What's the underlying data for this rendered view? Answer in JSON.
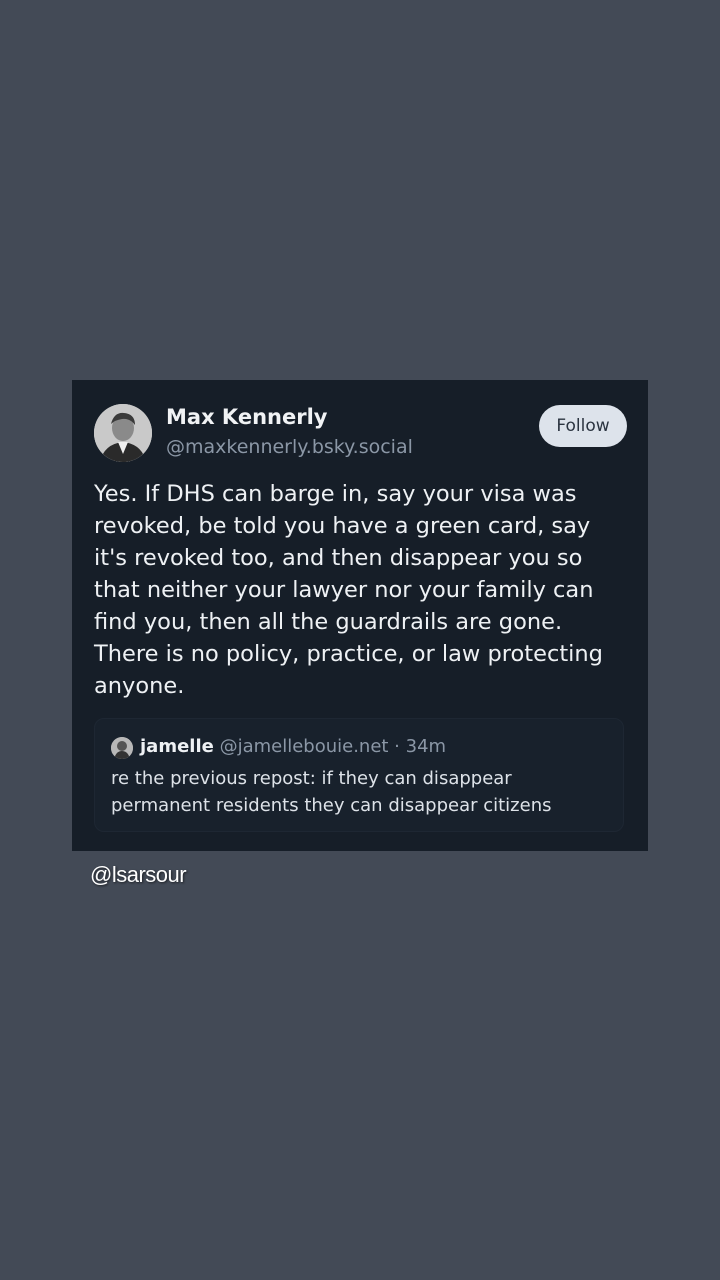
{
  "post": {
    "author_name": "Max Kennerly",
    "author_handle": "@maxkennerly.bsky.social",
    "follow_label": "Follow",
    "avatar_icon": "person-photo-avatar",
    "body_lines": [
      "Yes. If DHS can barge in, say your visa was",
      "revoked, be told you have a green card, say",
      "it's revoked too, and then disappear you so",
      "that neither your lawyer nor your family can",
      "find you, then all the guardrails are gone.",
      "There is no policy, practice, or law protecting",
      "anyone."
    ]
  },
  "quote": {
    "author_name": "jamelle",
    "author_meta": "@jamellebouie.net · 34m",
    "body_lines": [
      "re the previous repost: if they can disappear",
      "permanent residents they can disappear citizens"
    ]
  },
  "watermark": {
    "handle": "@lsarsour"
  },
  "colors": {
    "background": "#434a56",
    "card": "#161e28",
    "follow_button": "#dde3eb"
  }
}
